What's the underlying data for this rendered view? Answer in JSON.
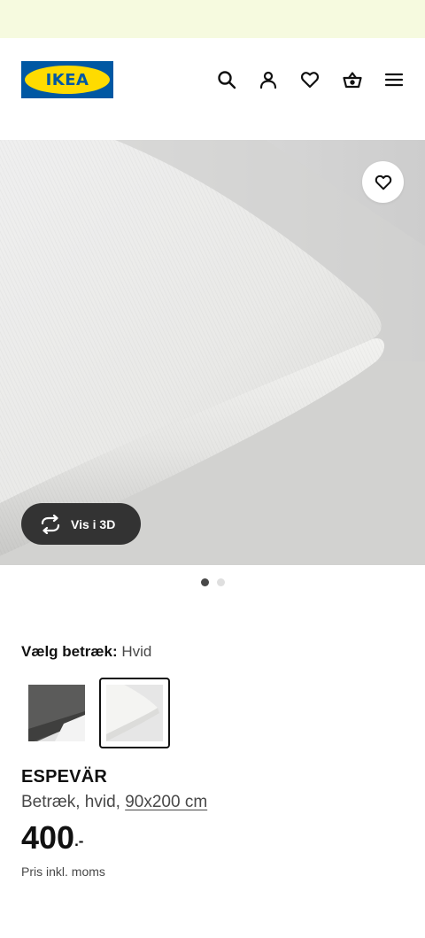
{
  "banner": {
    "background": "#f6fadf"
  },
  "header": {
    "logo_text": "IKEA",
    "brand_blue": "#0058a3",
    "brand_yellow": "#ffdb00",
    "icons": [
      "search-icon",
      "user-icon",
      "heart-icon",
      "basket-icon",
      "hamburger-menu-icon"
    ]
  },
  "hero": {
    "view_3d_label": "Vis i 3D",
    "favorite_icon": "heart-icon",
    "rotate_icon": "rotate-3d-icon",
    "slides_total": 2,
    "slide_active": 1
  },
  "variant": {
    "label": "Vælg betræk:",
    "value": "Hvid",
    "options": [
      "Grå",
      "Hvid"
    ],
    "selected_index": 1
  },
  "product": {
    "name": "ESPEVÄR",
    "description_prefix": "Betræk, hvid, ",
    "size": "90x200 cm",
    "price_integer": "400",
    "price_suffix": ".-",
    "price_note": "Pris inkl. moms"
  }
}
